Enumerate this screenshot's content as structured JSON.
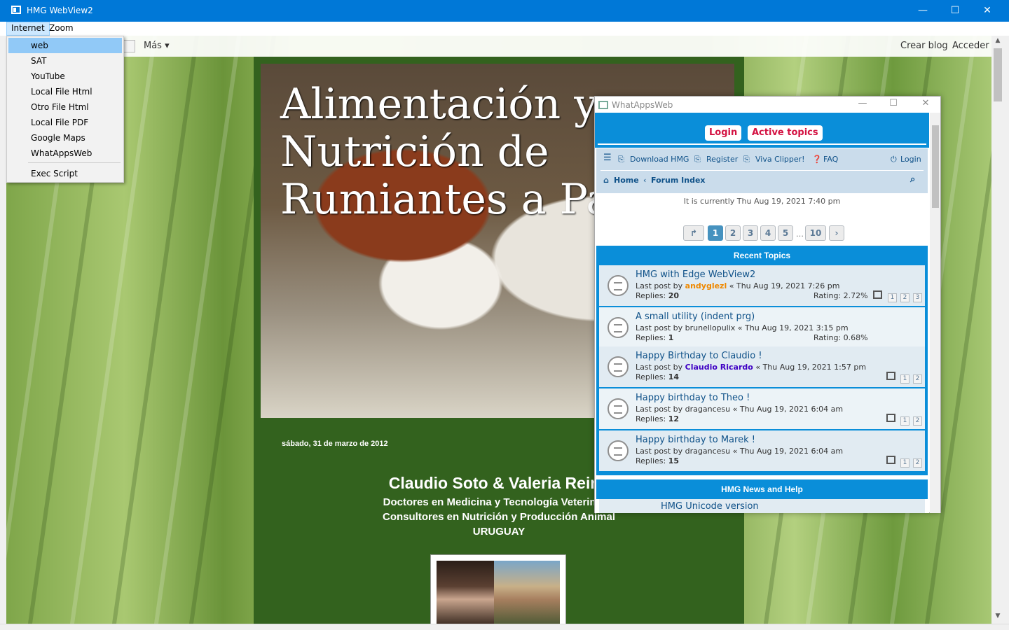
{
  "window": {
    "title": "HMG WebView2",
    "minimize": "—",
    "maximize": "☐",
    "close": "✕"
  },
  "menubar": {
    "items": [
      "Internet",
      "Zoom"
    ]
  },
  "internet_menu": {
    "items": [
      "web",
      "SAT",
      "YouTube",
      "Local File Html",
      "Otro File Html",
      "Local File PDF",
      "Google Maps",
      "WhatAppsWeb"
    ],
    "exec": "Exec Script",
    "highlighted": "web"
  },
  "blogger_nav": {
    "more": "Más ▾",
    "create": "Crear blog",
    "login": "Acceder"
  },
  "blog": {
    "title": "Alimentación y Nutrición de Rumiantes a Pasto",
    "date": "sábado, 31 de marzo de 2012",
    "authors": "Claudio Soto  &  Valeria Reina",
    "line1": "Doctores en Medicina y Tecnología Veterinaria",
    "line2": "Consultores en Nutrición y Producción Animal",
    "line3": "URUGUAY"
  },
  "popup": {
    "title": "WhatAppsWeb",
    "header_buttons": [
      "Login",
      "Active topics"
    ],
    "nav": {
      "download": "Download HMG",
      "register": "Register",
      "viva": "Viva Clipper!",
      "faq": "FAQ",
      "login": "Login",
      "home": "Home",
      "forum_index": "Forum Index"
    },
    "current_time": "It is currently Thu Aug 19, 2021 7:40 pm",
    "pages": [
      "1",
      "2",
      "3",
      "4",
      "5",
      "10"
    ],
    "ellipsis": "…",
    "recent_header": "Recent Topics",
    "topics": [
      {
        "title": "HMG with Edge WebView2",
        "author": "andyglezl",
        "author_color": "#ee8800",
        "date": "Thu Aug 19, 2021 7:26 pm",
        "replies": "20",
        "rating": "Rating: 2.72%",
        "mini_pages": [
          "1",
          "2",
          "3"
        ]
      },
      {
        "title": "A small utility (indent prg)",
        "author": "brunellopulix",
        "author_color": "#105289",
        "date": "Thu Aug 19, 2021 3:15 pm",
        "replies": "1",
        "rating": "Rating: 0.68%",
        "mini_pages": []
      },
      {
        "title": "Happy Birthday to Claudio !",
        "author": "Claudio Ricardo",
        "author_color": "#3f00c4",
        "date": "Thu Aug 19, 2021 1:57 pm",
        "replies": "14",
        "rating": "",
        "mini_pages": [
          "1",
          "2"
        ]
      },
      {
        "title": "Happy birthday to Theo !",
        "author": "dragancesu",
        "author_color": "#105289",
        "date": "Thu Aug 19, 2021 6:04 am",
        "replies": "12",
        "rating": "",
        "mini_pages": [
          "1",
          "2"
        ]
      },
      {
        "title": "Happy birthday to Marek !",
        "author": "dragancesu",
        "author_color": "#105289",
        "date": "Thu Aug 19, 2021 6:04 am",
        "replies": "15",
        "rating": "",
        "mini_pages": [
          "1",
          "2"
        ]
      }
    ],
    "last_post_label": "Last post by",
    "replies_label": "Replies:",
    "news_header": "HMG News and Help",
    "news_first": "HMG Unicode version"
  },
  "colors": {
    "titlebar": "#0078d7",
    "forum_blue": "#0a8ed9",
    "blog_green": "#33621e"
  }
}
